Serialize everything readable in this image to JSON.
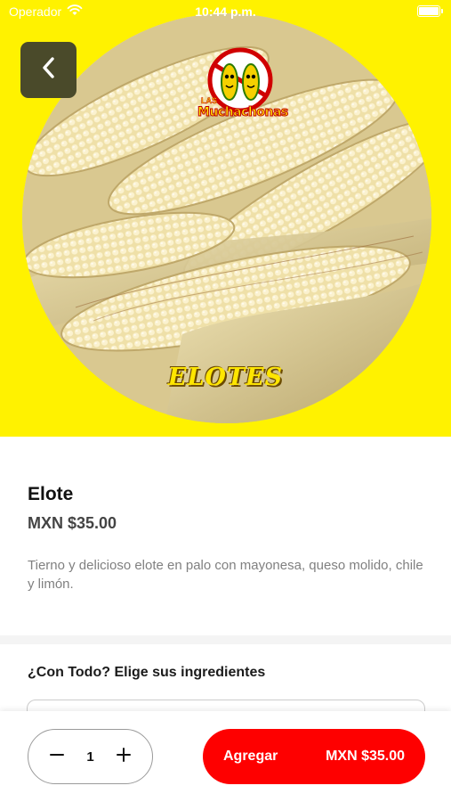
{
  "status_bar": {
    "carrier": "Operador",
    "time": "10:44 p.m."
  },
  "hero": {
    "logo_text": "Muchachonas",
    "logo_small": "LAS",
    "caption": "ELOTES",
    "background_color": "#fff200"
  },
  "product": {
    "name": "Elote",
    "price": "MXN $35.00",
    "description": "Tierno y delicioso elote en palo con mayonesa, queso molido, chile y limón."
  },
  "options": {
    "title": "¿Con Todo? Elige sus ingredientes"
  },
  "cart": {
    "quantity": "1",
    "add_label": "Agregar",
    "add_price": "MXN $35.00",
    "accent_color": "#fe0000"
  },
  "icons": {
    "back": "chevron-left-icon",
    "minus": "minus-icon",
    "plus": "plus-icon",
    "wifi": "wifi-icon",
    "battery": "battery-icon"
  }
}
